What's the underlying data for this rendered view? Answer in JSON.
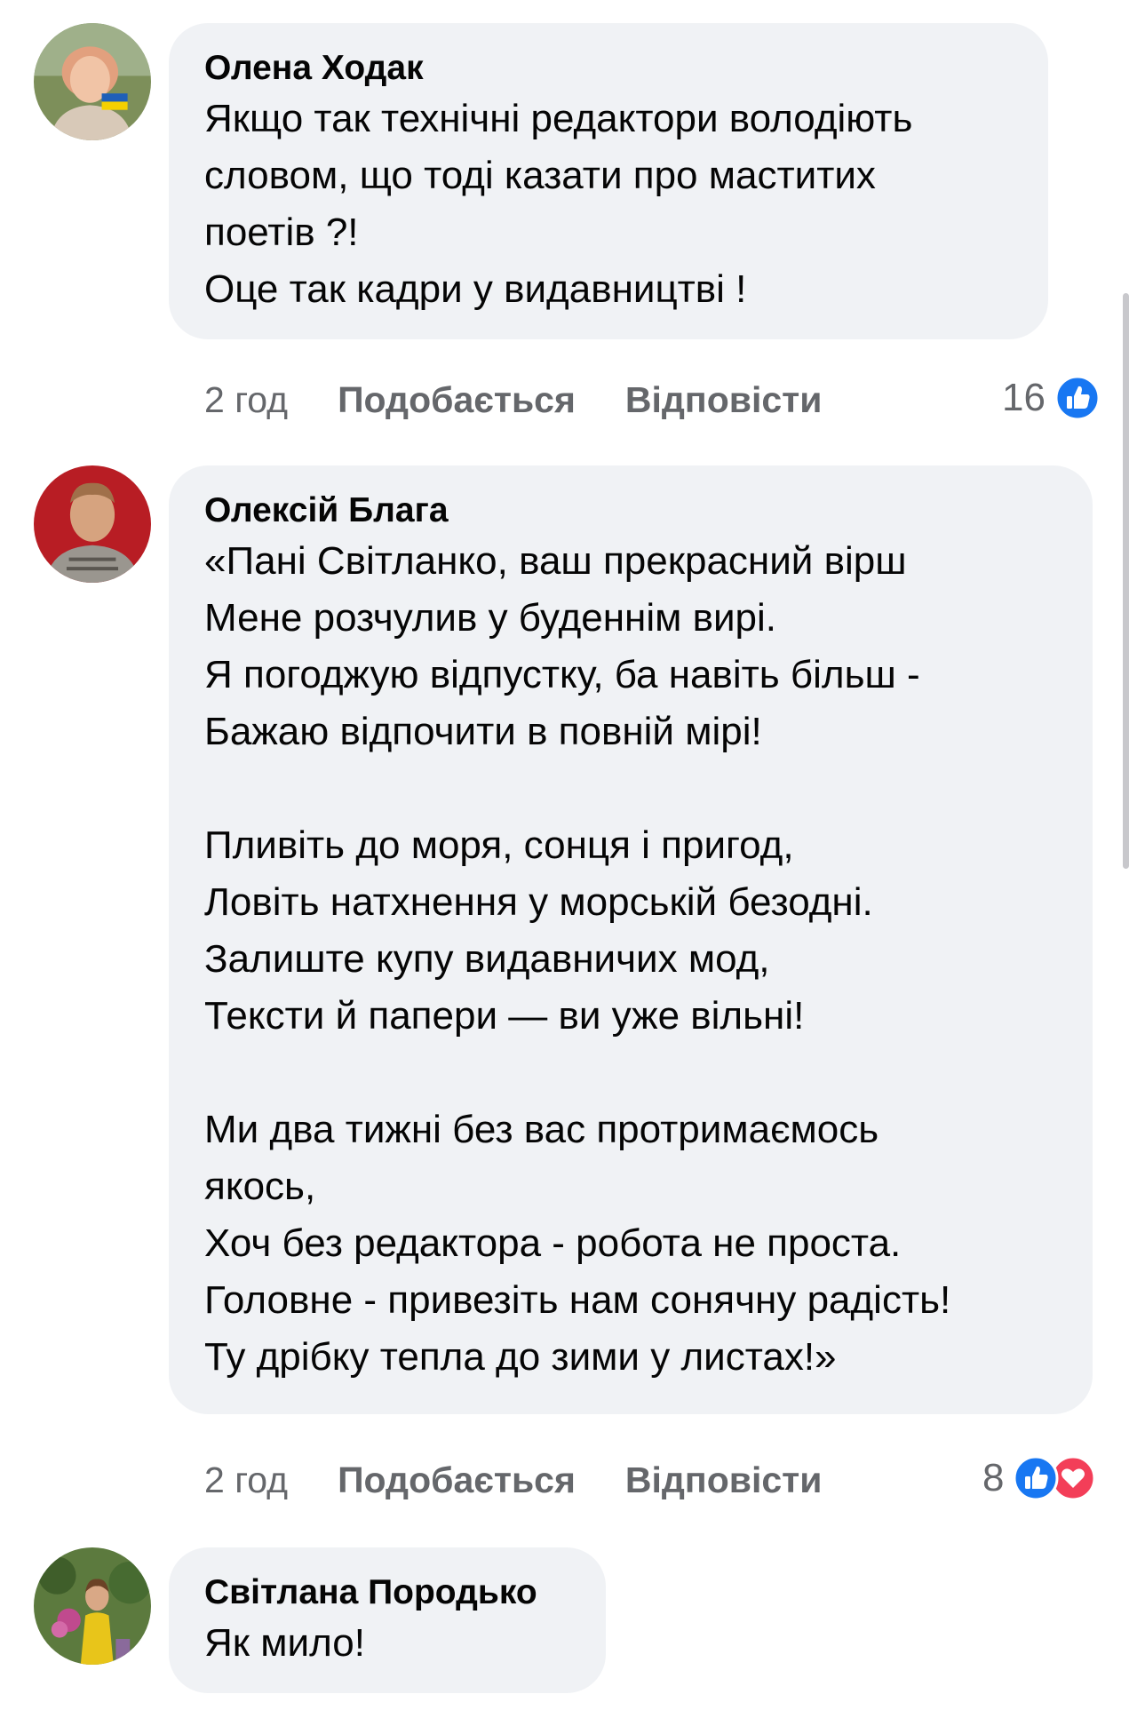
{
  "comments": [
    {
      "author": "Олена Ходак",
      "lines": [
        "Якщо так технічні редактори володіють",
        "словом, що тоді казати про маститих",
        "поетів ?!",
        "Оце так кадри у видавництві !"
      ],
      "time": "2 год",
      "like_label": "Подобається",
      "reply_label": "Відповісти",
      "reaction_count": "16",
      "reactions": [
        "like-icon"
      ]
    },
    {
      "author": "Олексій Блага",
      "stanza1": [
        "«Пані Світланко, ваш прекрасний вірш",
        "Мене розчулив у буденнім вирі.",
        "Я погоджую відпустку, ба навіть більш -",
        "Бажаю відпочити в повній мірі!"
      ],
      "stanza2": [
        "Пливіть до моря, сонця і пригод,",
        "Ловіть натхнення у морській безодні.",
        "Залиште купу видавничих мод,",
        "Тексти й папери — ви уже вільні!"
      ],
      "stanza3": [
        "Ми два тижні без вас протримаємось",
        "якось,",
        "Хоч без редактора - робота не проста.",
        "Головне - привезіть нам сонячну радість!",
        "Ту дрібку тепла до зими у листах!»"
      ],
      "time": "2 год",
      "like_label": "Подобається",
      "reply_label": "Відповісти",
      "reaction_count": "8",
      "reactions": [
        "like-icon",
        "love-icon"
      ]
    },
    {
      "author": "Світлана Породько",
      "lines": [
        "Як мило!"
      ]
    }
  ],
  "colors": {
    "bubble": "#f0f2f5",
    "meta_text": "#65676b",
    "like_blue": "#1877f2",
    "love_red": "#f33e58"
  }
}
